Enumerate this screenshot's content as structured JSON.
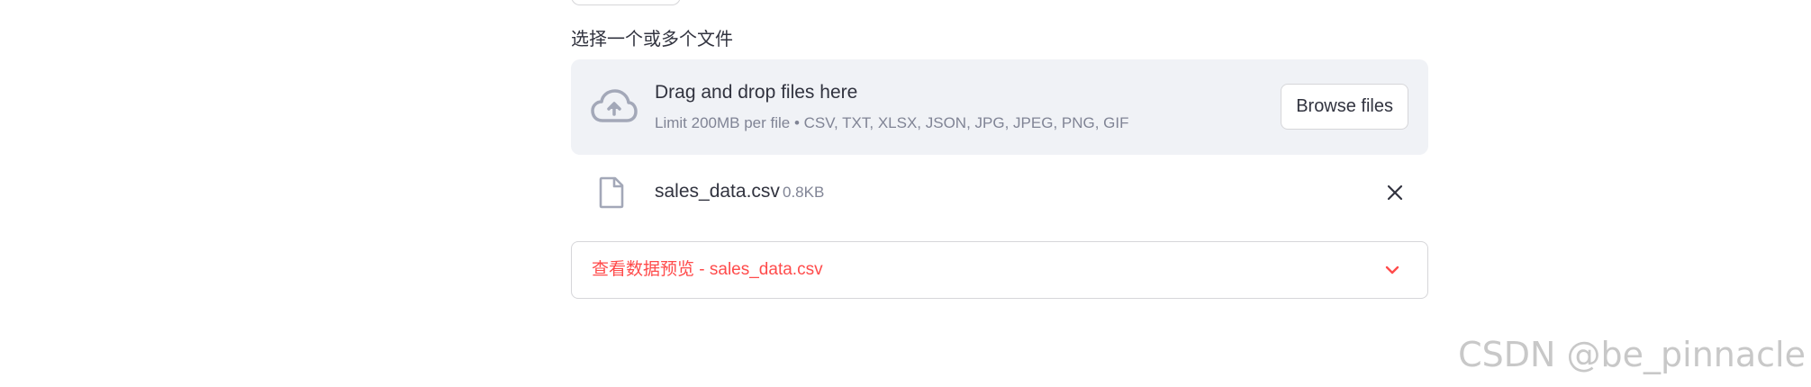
{
  "uploader": {
    "label": "选择一个或多个文件",
    "dropzone": {
      "title": "Drag and drop files here",
      "limit": "Limit 200MB per file • CSV, TXT, XLSX, JSON, JPG, JPEG, PNG, GIF",
      "browse_label": "Browse files",
      "icon": "cloud-upload-icon"
    },
    "files": [
      {
        "name": "sales_data.csv",
        "size": "0.8KB",
        "icon": "file-icon",
        "remove_icon": "close-icon"
      }
    ]
  },
  "expander": {
    "label": "查看数据预览 - sales_data.csv",
    "icon": "chevron-down-icon",
    "color": "#ff4b4b"
  },
  "watermark": {
    "text": "CSDN @be_pinnacle"
  },
  "colors": {
    "dropzone_bg": "#f0f2f6",
    "icon_gray": "#a3a8b8",
    "accent": "#ff4b4b"
  }
}
